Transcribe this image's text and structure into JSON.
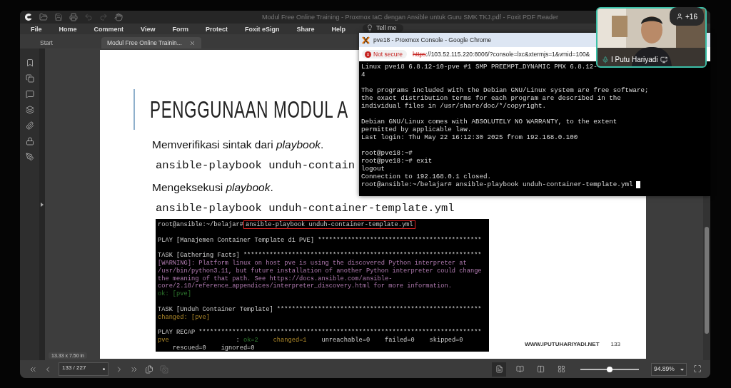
{
  "pdf_window": {
    "title": "Modul Free Online Training - Proxmox IaC dengan Ansible untuk Guru SMK TKJ.pdf - Foxit PDF Reader",
    "menu": [
      "File",
      "Home",
      "Comment",
      "View",
      "Form",
      "Protect",
      "Foxit eSign",
      "Share",
      "Help"
    ],
    "tell_me": "Tell me",
    "tabs": [
      {
        "label": "Start",
        "selected": false
      },
      {
        "label": "Modul Free Online Trainin...",
        "selected": true
      }
    ],
    "page_size": "13.33 x 7.50 in",
    "slide": {
      "title": "PENGGUNAAN MODUL A",
      "items": [
        {
          "kind": "text",
          "text": "Memverifikasi sintak dari *playbook*."
        },
        {
          "kind": "code",
          "text": "ansible-playbook unduh-contain"
        },
        {
          "kind": "text",
          "text": "Mengeksekusi *playbook*."
        },
        {
          "kind": "code",
          "text": "ansible-playbook unduh-container-template.yml"
        }
      ],
      "terminal": {
        "prompt": "root@ansible:~/belajar#",
        "command": "ansible-playbook unduh-container-template.yml",
        "blocks": [
          [
            [
              {
                "text": "PLAY [Manajemen Container Template di PVE] ********************************************",
                "kind": "plain"
              }
            ]
          ],
          [
            [
              {
                "text": "TASK [Gathering Facts] ****************************************************************",
                "kind": "plain"
              }
            ],
            [
              {
                "text": "[WARNING]: Platform linux on host pve is using the discovered Python interpreter at",
                "kind": "warning"
              }
            ],
            [
              {
                "text": "/usr/bin/python3.11, but future installation of another Python interpreter could change",
                "kind": "warning"
              }
            ],
            [
              {
                "text": "the meaning of that path. See https://docs.ansible.com/ansible-",
                "kind": "warning"
              }
            ],
            [
              {
                "text": "core/2.18/reference_appendices/interpreter_discovery.html for more information.",
                "kind": "warning"
              }
            ],
            [
              {
                "text": "ok: [pve]",
                "kind": "ok"
              }
            ]
          ],
          [
            [
              {
                "text": "TASK [Unduh Container Template] *******************************************************",
                "kind": "plain"
              }
            ],
            [
              {
                "text": "changed: [pve]",
                "kind": "changed"
              }
            ]
          ],
          [
            [
              {
                "text": "PLAY RECAP ****************************************************************************",
                "kind": "plain"
              }
            ],
            [
              {
                "text": "pve                  ",
                "kind": "changed"
              },
              {
                "text": ": ",
                "kind": "plain"
              },
              {
                "text": "ok=2",
                "kind": "ok"
              },
              {
                "text": "    changed=1",
                "kind": "changed"
              },
              {
                "text": "    unreachable=0    failed=0    skipped=0",
                "kind": "plain"
              }
            ],
            [
              {
                "text": "    rescued=0    ignored=0",
                "kind": "plain"
              }
            ]
          ]
        ]
      },
      "website": "WWW.IPUTUHARIYADI.NET",
      "page_number": "133"
    },
    "page_field": "133 / 227",
    "views": [
      {
        "selected": true
      },
      {
        "selected": false
      },
      {
        "selected": false
      },
      {
        "selected": false
      }
    ],
    "zoom_slider": {
      "level": 0.5
    },
    "zoom": "94.89%"
  },
  "console_window": {
    "title": "pve18 - Proxmox Console - Google Chrome",
    "security": "Not secure",
    "url_scheme": "https",
    "url_rest": "://103.52.115.220:8006/?console=lxc&xtermjs=1&vmid=100&",
    "blocks": [
      [
        "Linux pve18 6.8.12-10-pve #1 SMP PREEMPT_DYNAMIC PMX 6.8.12-",
        "4"
      ],
      [
        "The programs included with the Debian GNU/Linux system are free software;",
        "the exact distribution terms for each program are described in the",
        "individual files in /usr/share/doc/*/copyright."
      ],
      [
        "Debian GNU/Linux comes with ABSOLUTELY NO WARRANTY, to the extent",
        "permitted by applicable law.",
        "Last login: Thu May 22 16:12:30 2025 from 192.168.0.100"
      ],
      [
        "root@pve18:~#",
        "root@pve18:~# exit",
        "logout",
        "Connection to 192.168.0.1 closed.",
        "root@ansible:~/belajar# ansible-playbook unduh-container-template.yml"
      ]
    ]
  },
  "video": {
    "name": "I Putu Hariyadi",
    "participants": "+16"
  }
}
